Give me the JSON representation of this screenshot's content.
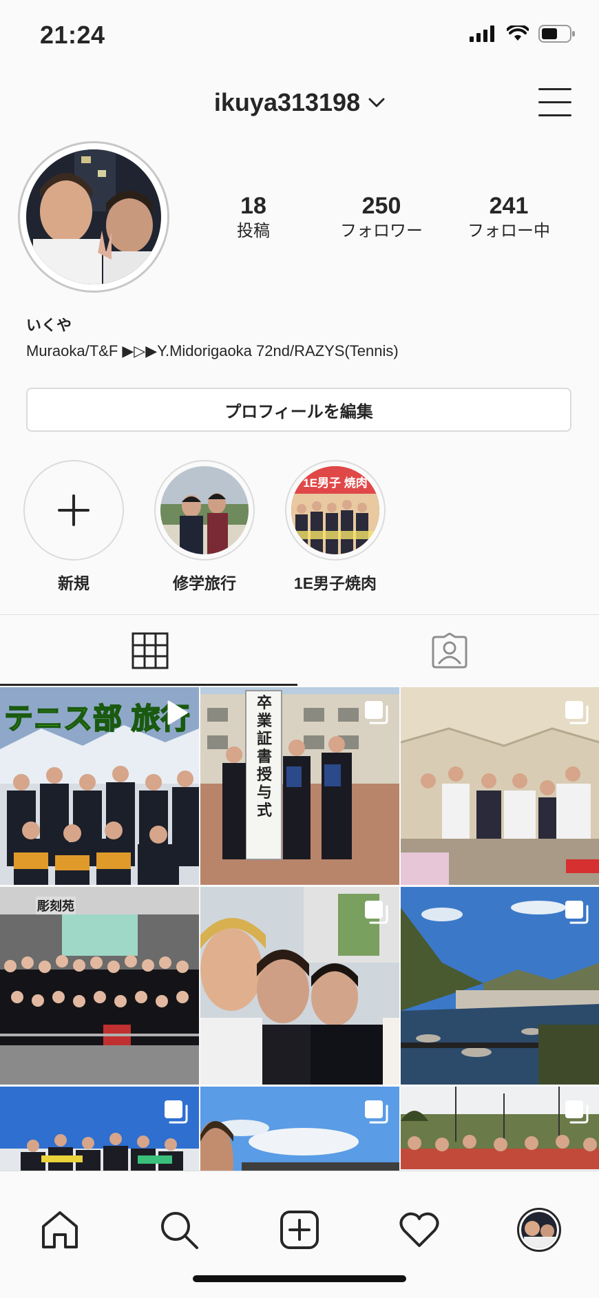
{
  "status_bar": {
    "time": "21:24"
  },
  "header": {
    "username": "ikuya313198"
  },
  "profile": {
    "stats": [
      {
        "count": "18",
        "label": "投稿"
      },
      {
        "count": "250",
        "label": "フォロワー"
      },
      {
        "count": "241",
        "label": "フォロー中"
      }
    ],
    "display_name": "いくや",
    "bio": "Muraoka/T&F ▶▷▶Y.Midorigaoka 72nd/RAZYS(Tennis)",
    "edit_button_label": "プロフィールを編集"
  },
  "highlights": [
    {
      "label": "新規",
      "icon": "plus-icon"
    },
    {
      "label": "修学旅行"
    },
    {
      "label": "1E男子焼肉",
      "cover_text": "1E男子 焼肉"
    }
  ],
  "tabs": [
    {
      "name": "grid",
      "icon": "grid-icon",
      "active": true
    },
    {
      "name": "tagged",
      "icon": "tagged-person-icon",
      "active": false
    }
  ],
  "posts": [
    {
      "type": "video",
      "overlay_text": "テニス部 旅行"
    },
    {
      "type": "carousel",
      "overlay_text": "卒業証書授与式"
    },
    {
      "type": "carousel"
    },
    {
      "type": "photo",
      "overlay_text": "彫刻苑"
    },
    {
      "type": "carousel"
    },
    {
      "type": "carousel"
    },
    {
      "type": "carousel"
    },
    {
      "type": "carousel"
    },
    {
      "type": "carousel"
    }
  ],
  "bottom_nav": [
    {
      "icon": "home-icon"
    },
    {
      "icon": "search-icon"
    },
    {
      "icon": "new-post-icon"
    },
    {
      "icon": "heart-icon"
    },
    {
      "icon": "profile-avatar"
    }
  ],
  "colors": {
    "text": "#262626",
    "border": "#dbdbdb",
    "background": "#fafafa",
    "overlay_green": "#7fff2a"
  }
}
